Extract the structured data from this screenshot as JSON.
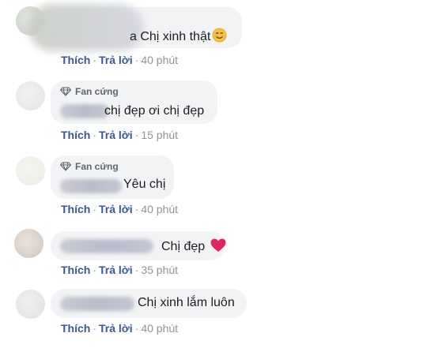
{
  "comments": [
    {
      "badge": "",
      "text": "a Chị xinh thật",
      "emoji": "smiling-face-icon",
      "like": "Thích",
      "reply": "Trả lời",
      "time": "40 phút"
    },
    {
      "badge": "Fan cứng",
      "text": "chị đẹp ơi chị đẹp",
      "like": "Thích",
      "reply": "Trả lời",
      "time": "15 phút"
    },
    {
      "badge": "Fan cứng",
      "text": "Yêu chị",
      "like": "Thích",
      "reply": "Trả lời",
      "time": "40 phút"
    },
    {
      "badge": "",
      "text": "Chị đẹp",
      "emoji": "red-heart-icon",
      "like": "Thích",
      "reply": "Trả lời",
      "time": "35 phút"
    },
    {
      "badge": "",
      "text": "Chị xinh lắm luôn",
      "like": "Thích",
      "reply": "Trả lời",
      "time": "40 phút"
    }
  ],
  "separator": "·",
  "colors": {
    "link": "#385898",
    "bubble": "#f2f3f5",
    "meta": "#90949c",
    "heart": "#e0245e"
  }
}
